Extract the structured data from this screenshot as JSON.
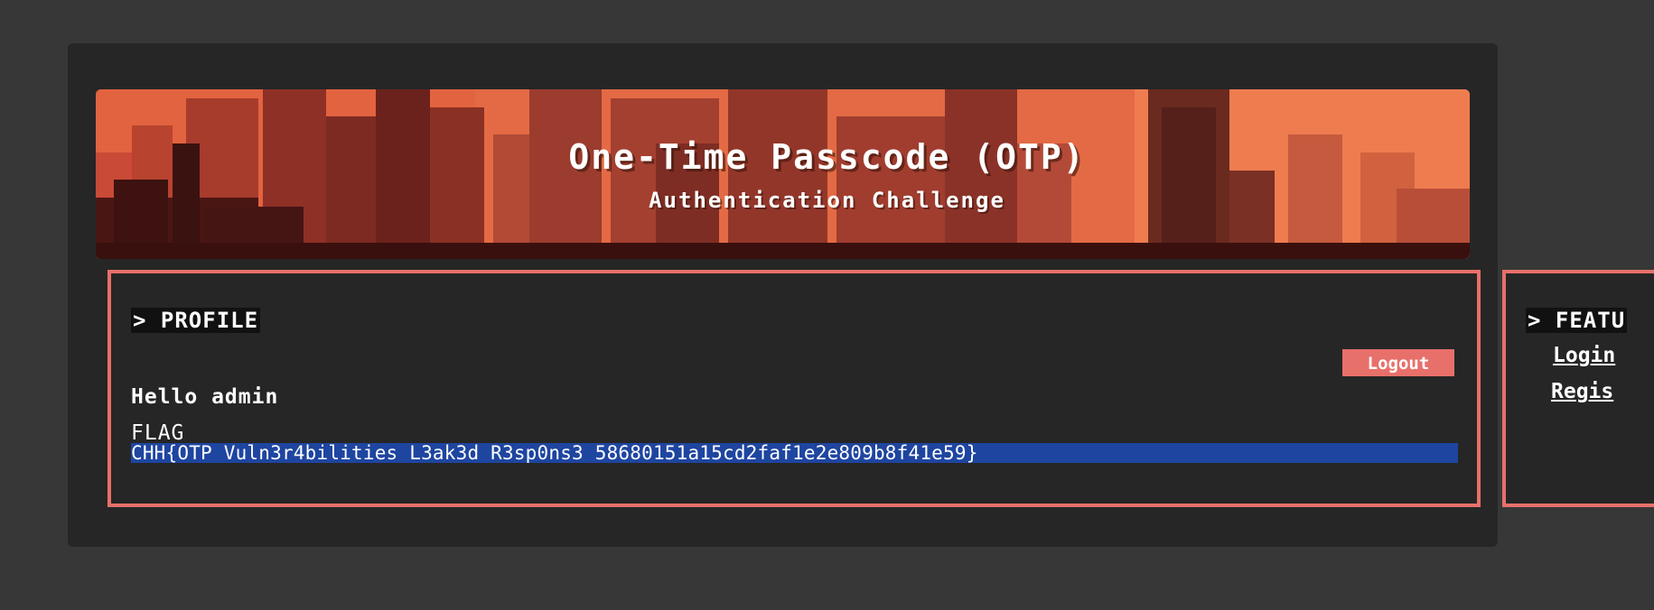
{
  "banner": {
    "title": "One-Time Passcode (OTP)",
    "subtitle": "Authentication Challenge"
  },
  "profile": {
    "heading": "> PROFILE",
    "logout_label": "Logout",
    "greeting": "Hello admin",
    "flag_label": "FLAG",
    "flag_value": "CHH{OTP_Vuln3r4bilities_L3ak3d_R3sp0ns3_58680151a15cd2faf1e2e809b8f41e59}"
  },
  "features": {
    "heading": "> FEATU",
    "links": [
      "Login",
      "Regis"
    ]
  },
  "colors": {
    "accent": "#e8706a",
    "background": "#373737",
    "panel": "#262626",
    "selection": "#1e45a0"
  }
}
